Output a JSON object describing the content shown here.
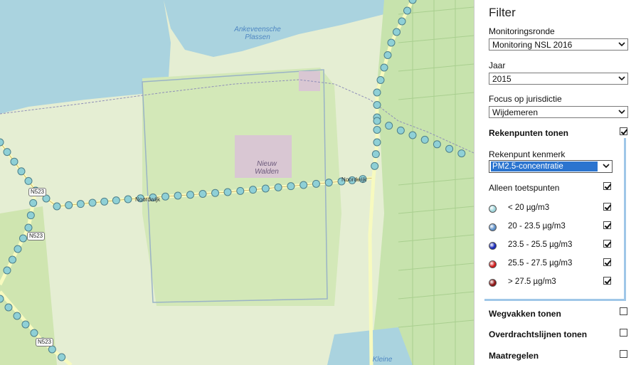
{
  "map": {
    "place_labels": [
      {
        "id": "ankeveense",
        "lines": [
          "Ankeveensche",
          "Plassen"
        ],
        "water": true
      },
      {
        "id": "nieuw-walden",
        "lines": [
          "Nieuw",
          "Walden"
        ],
        "water": false
      },
      {
        "id": "kleine",
        "lines": [
          "Kleine"
        ],
        "water": true
      }
    ],
    "road_shields": [
      "N523",
      "N523",
      "N523"
    ],
    "road_names": [
      "Noordwijk",
      "Noordwijk"
    ],
    "colors": {
      "land": "#e5eed3",
      "polder": "#cfe5b0",
      "water": "#aad3df",
      "road": "#f7fabf",
      "point_fill": "#8fd0d6"
    }
  },
  "panel": {
    "title": "Filter",
    "monitoringsronde": {
      "label": "Monitoringsronde",
      "value": "Monitoring NSL 2016"
    },
    "jaar": {
      "label": "Jaar",
      "value": "2015"
    },
    "focus": {
      "label": "Focus op jurisdictie",
      "value": "Wijdemeren"
    },
    "rekenpunten": {
      "label": "Rekenpunten tonen",
      "checked": true
    },
    "kenmerk": {
      "label": "Rekenpunt kenmerk",
      "value": "PM2.5-concentratie"
    },
    "toetspunten": {
      "label": "Alleen toetspunten",
      "checked": true
    },
    "legend": [
      {
        "label": "< 20 µg/m3",
        "color": "#9fd6dc",
        "checked": true
      },
      {
        "label": "20 - 23.5 µg/m3",
        "color": "#5b8fc9",
        "checked": true
      },
      {
        "label": "23.5 - 25.5 µg/m3",
        "color": "#1627b8",
        "checked": true
      },
      {
        "label": "25.5 - 27.5 µg/m3",
        "color": "#d11a1a",
        "checked": true
      },
      {
        "label": "> 27.5 µg/m3",
        "color": "#8e1212",
        "checked": true
      }
    ],
    "wegvakken": {
      "label": "Wegvakken tonen",
      "checked": false
    },
    "overdracht": {
      "label": "Overdrachtslijnen tonen",
      "checked": false
    },
    "maatregelen": {
      "label": "Maatregelen",
      "checked": false
    }
  }
}
